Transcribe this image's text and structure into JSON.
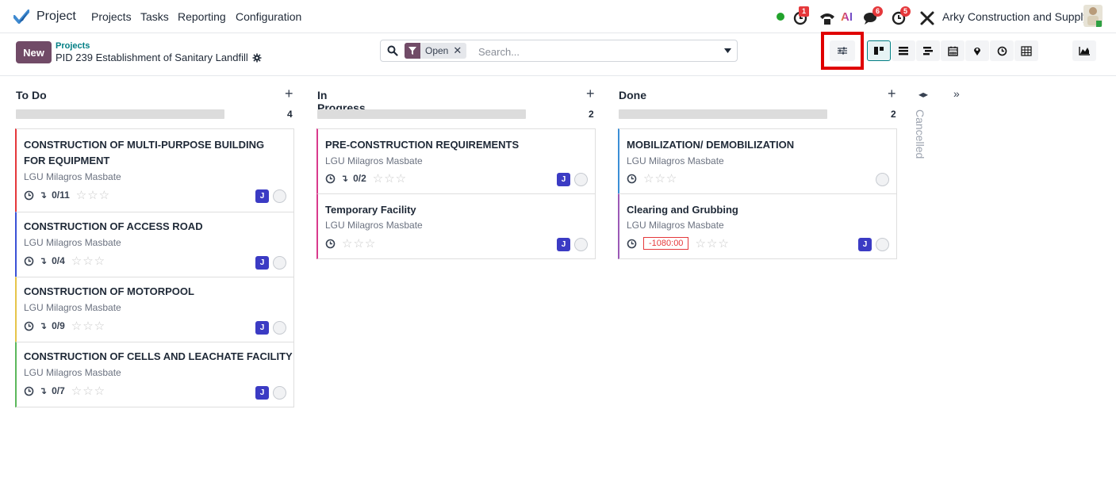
{
  "navbar": {
    "app_name": "Project",
    "menu": [
      "Projects",
      "Tasks",
      "Reporting",
      "Configuration"
    ],
    "badges": {
      "activity": "1",
      "discuss": "6",
      "clock": "5"
    },
    "ai_label": "AI",
    "company": "Arky Construction and Supply"
  },
  "control": {
    "new_label": "New",
    "breadcrumb_parent": "Projects",
    "breadcrumb_current": "PID 239 Establishment of Sanitary Landfill",
    "facet_label": "Open",
    "facet_remove": "✕",
    "search_placeholder": "Search..."
  },
  "columns": [
    {
      "title": "To Do",
      "count": "4",
      "progress": 0.0
    },
    {
      "title": "In Progress",
      "count": "2",
      "progress": 0.0
    },
    {
      "title": "Done",
      "count": "2",
      "progress": 0.0
    }
  ],
  "folded_column": "Cancelled",
  "cards": [
    {
      "title_lines": [
        "CONSTRUCTION OF MULTI-PURPOSE BUILDING",
        "FOR EQUIPMENT"
      ],
      "project": "LGU Milagros Masbate",
      "subtasks": "0/11",
      "user": "J",
      "color": "#e5383b"
    },
    {
      "title_lines": [
        "CONSTRUCTION OF ACCESS ROAD"
      ],
      "project": "LGU Milagros Masbate",
      "subtasks": "0/4",
      "user": "J",
      "color": "#3b52d6"
    },
    {
      "title_lines": [
        "CONSTRUCTION OF MOTORPOOL"
      ],
      "project": "LGU Milagros Masbate",
      "subtasks": "0/9",
      "user": "J",
      "color": "#e6c54a"
    },
    {
      "title_lines": [
        "CONSTRUCTION OF CELLS AND LEACHATE FACILITY"
      ],
      "project": "LGU Milagros Masbate",
      "subtasks": "0/7",
      "user": "J",
      "color": "#5cb85c"
    },
    {
      "title_lines": [
        "PRE-CONSTRUCTION REQUIREMENTS"
      ],
      "project": "LGU Milagros Masbate",
      "subtasks": "0/2",
      "user": "J",
      "color": "#d93a8c"
    },
    {
      "title_lines": [
        "Temporary Facility"
      ],
      "project": "LGU Milagros Masbate",
      "subtasks": "",
      "user": "J",
      "color": "#d93a8c"
    },
    {
      "title_lines": [
        "MOBILIZATION/ DEMOBILIZATION"
      ],
      "project": "LGU Milagros Masbate",
      "subtasks": "",
      "user": "",
      "color": "#3b8ed6"
    },
    {
      "title_lines": [
        "Clearing and Grubbing"
      ],
      "project": "LGU Milagros Masbate",
      "subtasks": "",
      "deadline": "-1080:00",
      "user": "J",
      "color": "#9b59b6"
    }
  ],
  "stars": "☆☆☆",
  "icons": {
    "app": "project-check-icon",
    "settings": "sliders-icon",
    "views": [
      "kanban-icon",
      "list-icon",
      "gantt-icon",
      "calendar-icon",
      "map-pin-icon",
      "activity-icon",
      "pivot-icon",
      "graph-icon"
    ]
  }
}
